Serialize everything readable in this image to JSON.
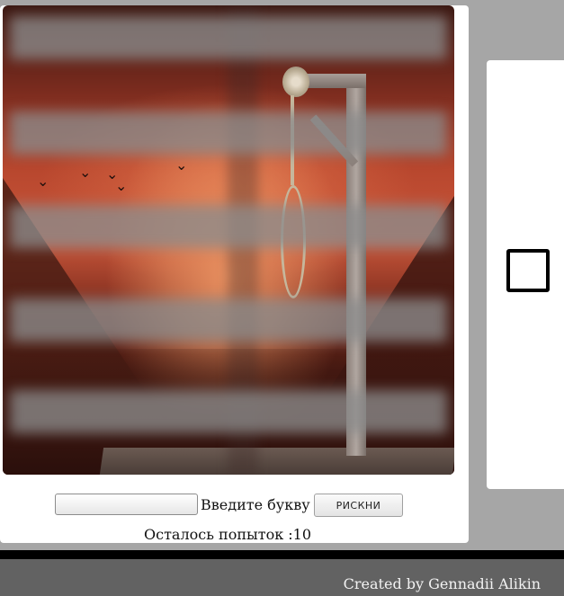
{
  "game": {
    "input_value": "",
    "input_label": "Введите букву",
    "guess_button": "РИСКНИ",
    "attempts_text": "Осталось попыток :10"
  },
  "footer": {
    "credit": "Created by Gennadii Alikin"
  },
  "colors": {
    "page_bg": "#a6a6a6",
    "footer_bg": "#626262",
    "divider": "#000000",
    "card_bg": "#ffffff"
  },
  "icons": {
    "letter_placeholder": "empty-square"
  }
}
